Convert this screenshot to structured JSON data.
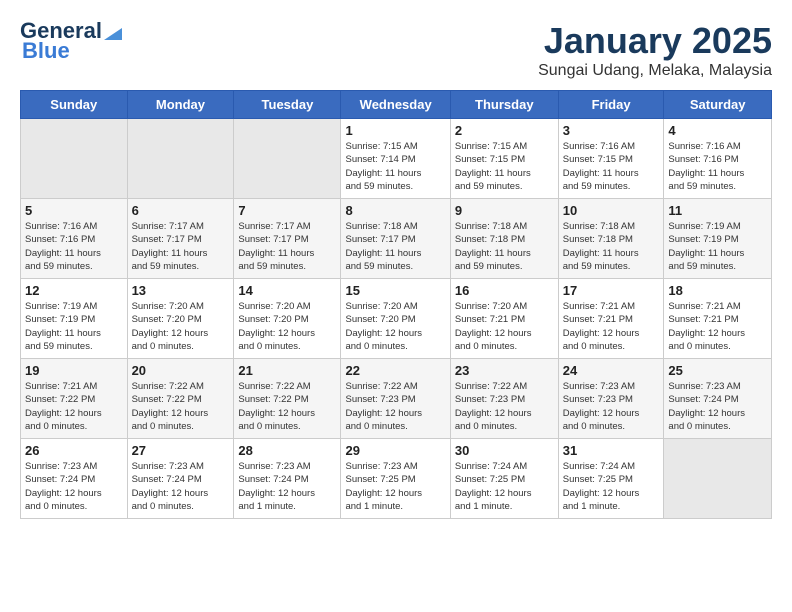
{
  "logo": {
    "text_general": "General",
    "text_blue": "Blue",
    "icon": "▶"
  },
  "title": "January 2025",
  "subtitle": "Sungai Udang, Melaka, Malaysia",
  "days_of_week": [
    "Sunday",
    "Monday",
    "Tuesday",
    "Wednesday",
    "Thursday",
    "Friday",
    "Saturday"
  ],
  "weeks": [
    [
      {
        "day": "",
        "info": ""
      },
      {
        "day": "",
        "info": ""
      },
      {
        "day": "",
        "info": ""
      },
      {
        "day": "1",
        "info": "Sunrise: 7:15 AM\nSunset: 7:14 PM\nDaylight: 11 hours\nand 59 minutes."
      },
      {
        "day": "2",
        "info": "Sunrise: 7:15 AM\nSunset: 7:15 PM\nDaylight: 11 hours\nand 59 minutes."
      },
      {
        "day": "3",
        "info": "Sunrise: 7:16 AM\nSunset: 7:15 PM\nDaylight: 11 hours\nand 59 minutes."
      },
      {
        "day": "4",
        "info": "Sunrise: 7:16 AM\nSunset: 7:16 PM\nDaylight: 11 hours\nand 59 minutes."
      }
    ],
    [
      {
        "day": "5",
        "info": "Sunrise: 7:16 AM\nSunset: 7:16 PM\nDaylight: 11 hours\nand 59 minutes."
      },
      {
        "day": "6",
        "info": "Sunrise: 7:17 AM\nSunset: 7:17 PM\nDaylight: 11 hours\nand 59 minutes."
      },
      {
        "day": "7",
        "info": "Sunrise: 7:17 AM\nSunset: 7:17 PM\nDaylight: 11 hours\nand 59 minutes."
      },
      {
        "day": "8",
        "info": "Sunrise: 7:18 AM\nSunset: 7:17 PM\nDaylight: 11 hours\nand 59 minutes."
      },
      {
        "day": "9",
        "info": "Sunrise: 7:18 AM\nSunset: 7:18 PM\nDaylight: 11 hours\nand 59 minutes."
      },
      {
        "day": "10",
        "info": "Sunrise: 7:18 AM\nSunset: 7:18 PM\nDaylight: 11 hours\nand 59 minutes."
      },
      {
        "day": "11",
        "info": "Sunrise: 7:19 AM\nSunset: 7:19 PM\nDaylight: 11 hours\nand 59 minutes."
      }
    ],
    [
      {
        "day": "12",
        "info": "Sunrise: 7:19 AM\nSunset: 7:19 PM\nDaylight: 11 hours\nand 59 minutes."
      },
      {
        "day": "13",
        "info": "Sunrise: 7:20 AM\nSunset: 7:20 PM\nDaylight: 12 hours\nand 0 minutes."
      },
      {
        "day": "14",
        "info": "Sunrise: 7:20 AM\nSunset: 7:20 PM\nDaylight: 12 hours\nand 0 minutes."
      },
      {
        "day": "15",
        "info": "Sunrise: 7:20 AM\nSunset: 7:20 PM\nDaylight: 12 hours\nand 0 minutes."
      },
      {
        "day": "16",
        "info": "Sunrise: 7:20 AM\nSunset: 7:21 PM\nDaylight: 12 hours\nand 0 minutes."
      },
      {
        "day": "17",
        "info": "Sunrise: 7:21 AM\nSunset: 7:21 PM\nDaylight: 12 hours\nand 0 minutes."
      },
      {
        "day": "18",
        "info": "Sunrise: 7:21 AM\nSunset: 7:21 PM\nDaylight: 12 hours\nand 0 minutes."
      }
    ],
    [
      {
        "day": "19",
        "info": "Sunrise: 7:21 AM\nSunset: 7:22 PM\nDaylight: 12 hours\nand 0 minutes."
      },
      {
        "day": "20",
        "info": "Sunrise: 7:22 AM\nSunset: 7:22 PM\nDaylight: 12 hours\nand 0 minutes."
      },
      {
        "day": "21",
        "info": "Sunrise: 7:22 AM\nSunset: 7:22 PM\nDaylight: 12 hours\nand 0 minutes."
      },
      {
        "day": "22",
        "info": "Sunrise: 7:22 AM\nSunset: 7:23 PM\nDaylight: 12 hours\nand 0 minutes."
      },
      {
        "day": "23",
        "info": "Sunrise: 7:22 AM\nSunset: 7:23 PM\nDaylight: 12 hours\nand 0 minutes."
      },
      {
        "day": "24",
        "info": "Sunrise: 7:23 AM\nSunset: 7:23 PM\nDaylight: 12 hours\nand 0 minutes."
      },
      {
        "day": "25",
        "info": "Sunrise: 7:23 AM\nSunset: 7:24 PM\nDaylight: 12 hours\nand 0 minutes."
      }
    ],
    [
      {
        "day": "26",
        "info": "Sunrise: 7:23 AM\nSunset: 7:24 PM\nDaylight: 12 hours\nand 0 minutes."
      },
      {
        "day": "27",
        "info": "Sunrise: 7:23 AM\nSunset: 7:24 PM\nDaylight: 12 hours\nand 0 minutes."
      },
      {
        "day": "28",
        "info": "Sunrise: 7:23 AM\nSunset: 7:24 PM\nDaylight: 12 hours\nand 1 minute."
      },
      {
        "day": "29",
        "info": "Sunrise: 7:23 AM\nSunset: 7:25 PM\nDaylight: 12 hours\nand 1 minute."
      },
      {
        "day": "30",
        "info": "Sunrise: 7:24 AM\nSunset: 7:25 PM\nDaylight: 12 hours\nand 1 minute."
      },
      {
        "day": "31",
        "info": "Sunrise: 7:24 AM\nSunset: 7:25 PM\nDaylight: 12 hours\nand 1 minute."
      },
      {
        "day": "",
        "info": ""
      }
    ]
  ]
}
